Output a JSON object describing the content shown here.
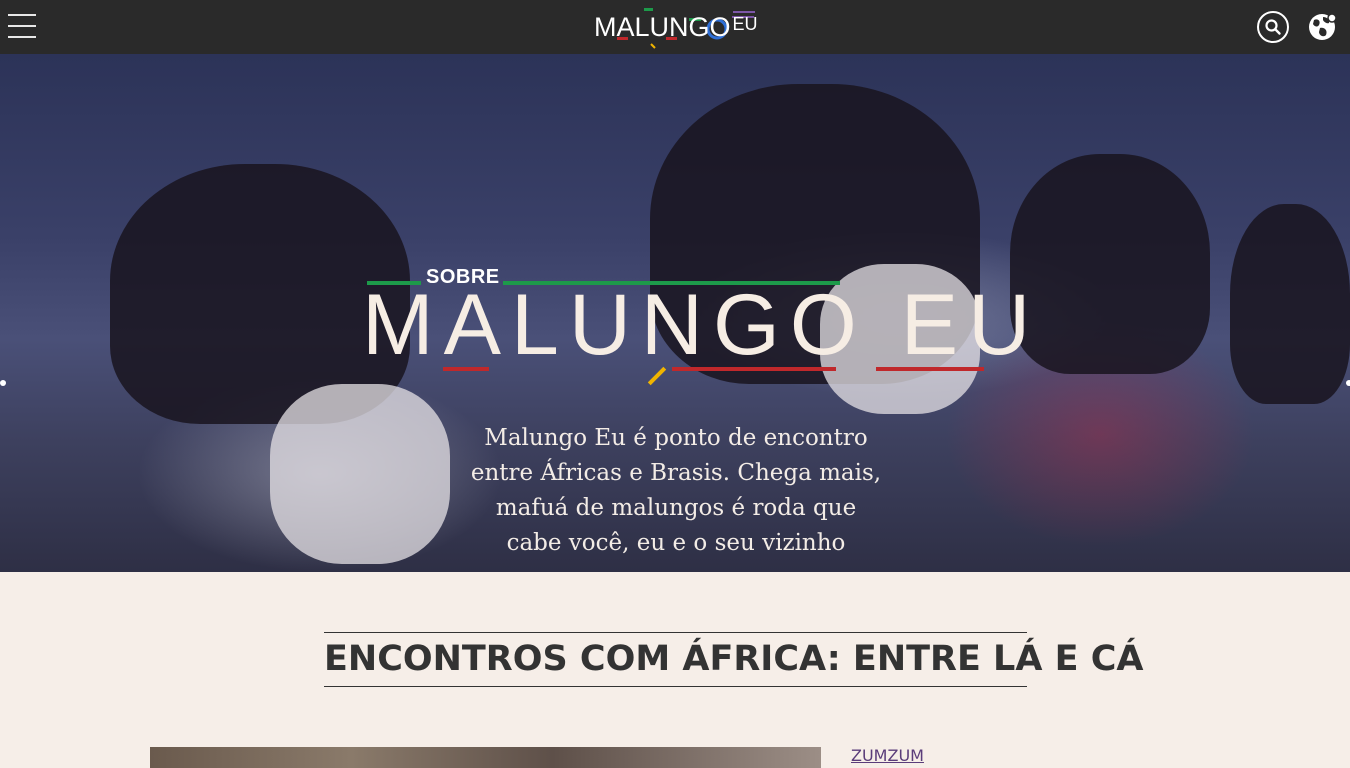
{
  "header": {
    "logo_text": "MALUNGO",
    "logo_suffix": "EU",
    "menu_icon": "hamburger-menu-icon",
    "search_icon": "search-icon",
    "language_icon": "globe-icon"
  },
  "hero": {
    "kicker": "SOBRE",
    "title": "MALUNGO EU",
    "description": "Malungo Eu é ponto de encontro entre Áfricas e Brasis. Chega mais, mafuá de malungos é roda que cabe você, eu e o seu vizinho"
  },
  "section": {
    "heading": "ENCONTROS COM ÁFRICA: ENTRE LÁ E CÁ"
  },
  "article": {
    "category": "ZUMZUM"
  },
  "colors": {
    "topbar": "#2a2a2a",
    "page_bg": "#f6eee8",
    "accent_green": "#1d9a4a",
    "accent_red": "#c0282b",
    "accent_yellow": "#f0b400",
    "accent_purple": "#7d57a8"
  }
}
